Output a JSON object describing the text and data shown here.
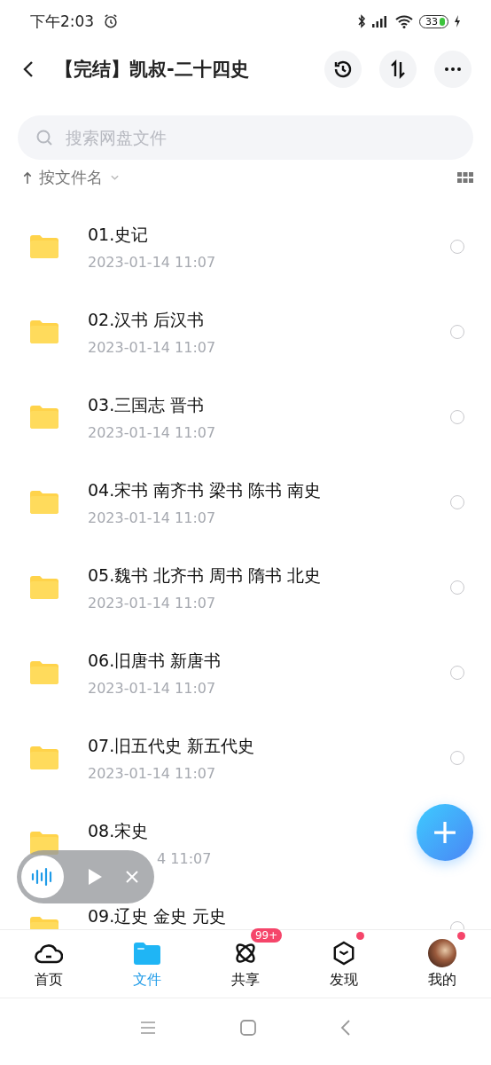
{
  "status_bar": {
    "time": "下午2:03",
    "battery": "33"
  },
  "header": {
    "title": "【完结】凯叔-二十四史"
  },
  "search": {
    "placeholder": "搜索网盘文件"
  },
  "sort": {
    "label": "按文件名"
  },
  "files": [
    {
      "name": "01.史记",
      "date": "2023-01-14  11:07",
      "selected": false
    },
    {
      "name": "02.汉书 后汉书",
      "date": "2023-01-14  11:07",
      "selected": false
    },
    {
      "name": "03.三国志 晋书",
      "date": "2023-01-14  11:07",
      "selected": false
    },
    {
      "name": "04.宋书 南齐书 梁书 陈书 南史",
      "date": "2023-01-14  11:07",
      "selected": false
    },
    {
      "name": "05.魏书 北齐书 周书 隋书 北史",
      "date": "2023-01-14  11:07",
      "selected": false
    },
    {
      "name": "06.旧唐书 新唐书",
      "date": "2023-01-14  11:07",
      "selected": false
    },
    {
      "name": "07.旧五代史 新五代史",
      "date": "2023-01-14  11:07",
      "selected": false
    },
    {
      "name": "08.宋史",
      "date": "4  11:07",
      "covered": true
    },
    {
      "name": "09.辽史 金史 元史",
      "selected": false
    }
  ],
  "player": {
    "playing": false
  },
  "nav": [
    {
      "label": "首页",
      "kind": "cloud",
      "selected": false
    },
    {
      "label": "文件",
      "kind": "folder",
      "selected": true
    },
    {
      "label": "共享",
      "kind": "atom",
      "selected": false,
      "badge": "99+"
    },
    {
      "label": "发现",
      "kind": "cube",
      "selected": false,
      "dot": true
    },
    {
      "label": "我的",
      "kind": "avatar",
      "selected": false,
      "dot": true
    }
  ]
}
